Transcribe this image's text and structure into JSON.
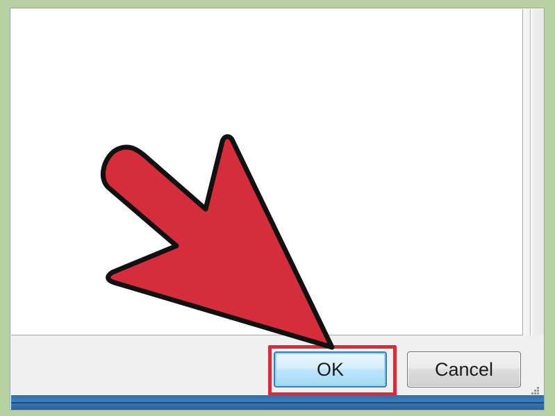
{
  "dialog": {
    "buttons": {
      "ok_label": "OK",
      "cancel_label": "Cancel"
    }
  },
  "annotation": {
    "arrow_color": "#d62d3d",
    "highlight_color": "#d62d3d",
    "target": "ok-button"
  },
  "colors": {
    "background": "#b9d1a2",
    "dialog_bg": "#f0f0f0",
    "ok_border": "#3c7fb1",
    "taskbar": "#3b7fbd"
  }
}
